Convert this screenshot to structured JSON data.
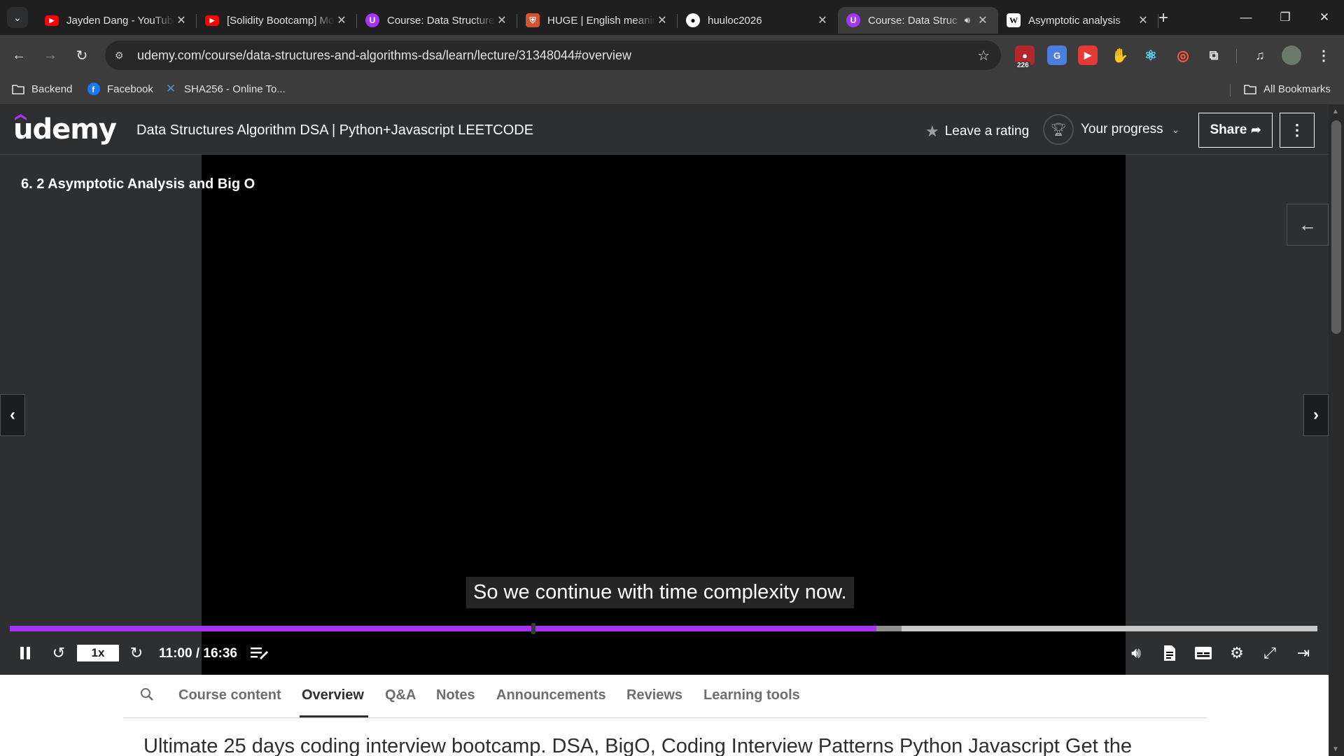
{
  "browser": {
    "tabs": [
      {
        "title": "Jayden Dang - YouTube",
        "favicon": "youtube-icon",
        "color": "#ff0000",
        "active": false
      },
      {
        "title": "[Solidity Bootcamp] Moc",
        "favicon": "youtube-icon",
        "color": "#ff0000",
        "active": false
      },
      {
        "title": "Course: Data Structures",
        "favicon": "udemy-icon",
        "color": "#a435f0",
        "active": false
      },
      {
        "title": "HUGE | English meaning",
        "favicon": "cambridge-icon",
        "color": "#d35230",
        "active": false
      },
      {
        "title": "huuloc2026",
        "favicon": "github-icon",
        "color": "#ffffff",
        "active": false
      },
      {
        "title": "Course: Data Struc",
        "favicon": "udemy-icon",
        "color": "#a435f0",
        "active": true,
        "audio": true
      },
      {
        "title": "Asymptotic analysis",
        "favicon": "wikipedia-icon",
        "color": "#ffffff",
        "active": false
      }
    ],
    "url": "udemy.com/course/data-structures-and-algorithms-dsa/learn/lecture/31348044#overview",
    "extension_badge": "226",
    "bookmarks": [
      {
        "label": "Backend",
        "icon": "folder-icon"
      },
      {
        "label": "Facebook",
        "icon": "facebook-icon"
      },
      {
        "label": "SHA256 - Online To...",
        "icon": "tools-icon"
      }
    ],
    "all_bookmarks": "All Bookmarks"
  },
  "header": {
    "logo": "udemy",
    "course_title": "Data Structures Algorithm DSA | Python+Javascript LEETCODE",
    "leave_rating": "Leave a rating",
    "your_progress": "Your progress",
    "share": "Share"
  },
  "player": {
    "lecture_title": "6. 2 Asymptotic Analysis and Big O",
    "caption": "So we continue with time complexity now.",
    "speed": "1x",
    "time": "11:00 / 16:36",
    "current_seconds": 660,
    "duration_seconds": 996,
    "chapter_marker_fraction": 0.399
  },
  "subnav": {
    "tabs": [
      "Course content",
      "Overview",
      "Q&A",
      "Notes",
      "Announcements",
      "Reviews",
      "Learning tools"
    ],
    "active": "Overview"
  },
  "description": "Ultimate 25 days coding interview bootcamp. DSA, BigO, Coding Interview Patterns Python Javascript Get the",
  "colors": {
    "udemy_purple": "#a435f0",
    "header_bg": "#2d2f31",
    "chrome_bg": "#3c3c3c"
  }
}
